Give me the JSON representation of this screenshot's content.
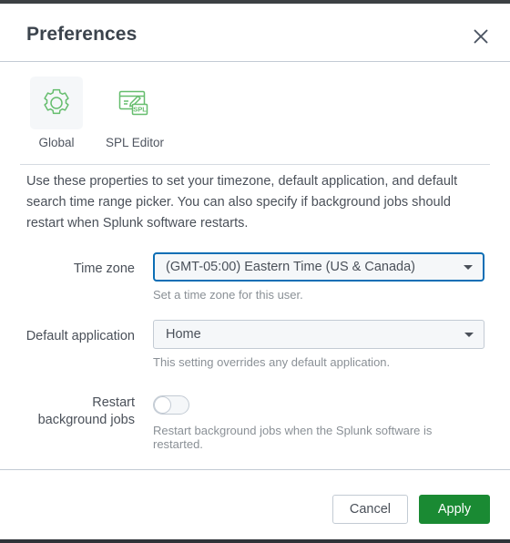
{
  "window": {
    "title": "Preferences",
    "close_icon": "close-icon"
  },
  "tabs": [
    {
      "label": "Global",
      "icon": "gear-icon",
      "selected": true
    },
    {
      "label": "SPL Editor",
      "icon": "spl-editor-icon",
      "selected": false
    }
  ],
  "description": "Use these properties to set your timezone, default application, and default search time range picker. You can also specify if background jobs should restart when Splunk software restarts.",
  "fields": {
    "time_zone": {
      "label": "Time zone",
      "value": "(GMT-05:00) Eastern Time (US & Canada)",
      "help": "Set a time zone for this user.",
      "focused": true
    },
    "default_application": {
      "label": "Default application",
      "value": "Home",
      "help": "This setting overrides any default application.",
      "focused": false
    },
    "restart_background_jobs": {
      "label_line1": "Restart",
      "label_line2": "background jobs",
      "state": "off",
      "help": "Restart background jobs when the Splunk software is restarted."
    }
  },
  "footer": {
    "cancel_label": "Cancel",
    "apply_label": "Apply"
  },
  "colors": {
    "accent_green": "#1a8a33",
    "focus_blue": "#0c6eb5",
    "icon_green": "#65bd6d",
    "text": "#4a5059"
  }
}
